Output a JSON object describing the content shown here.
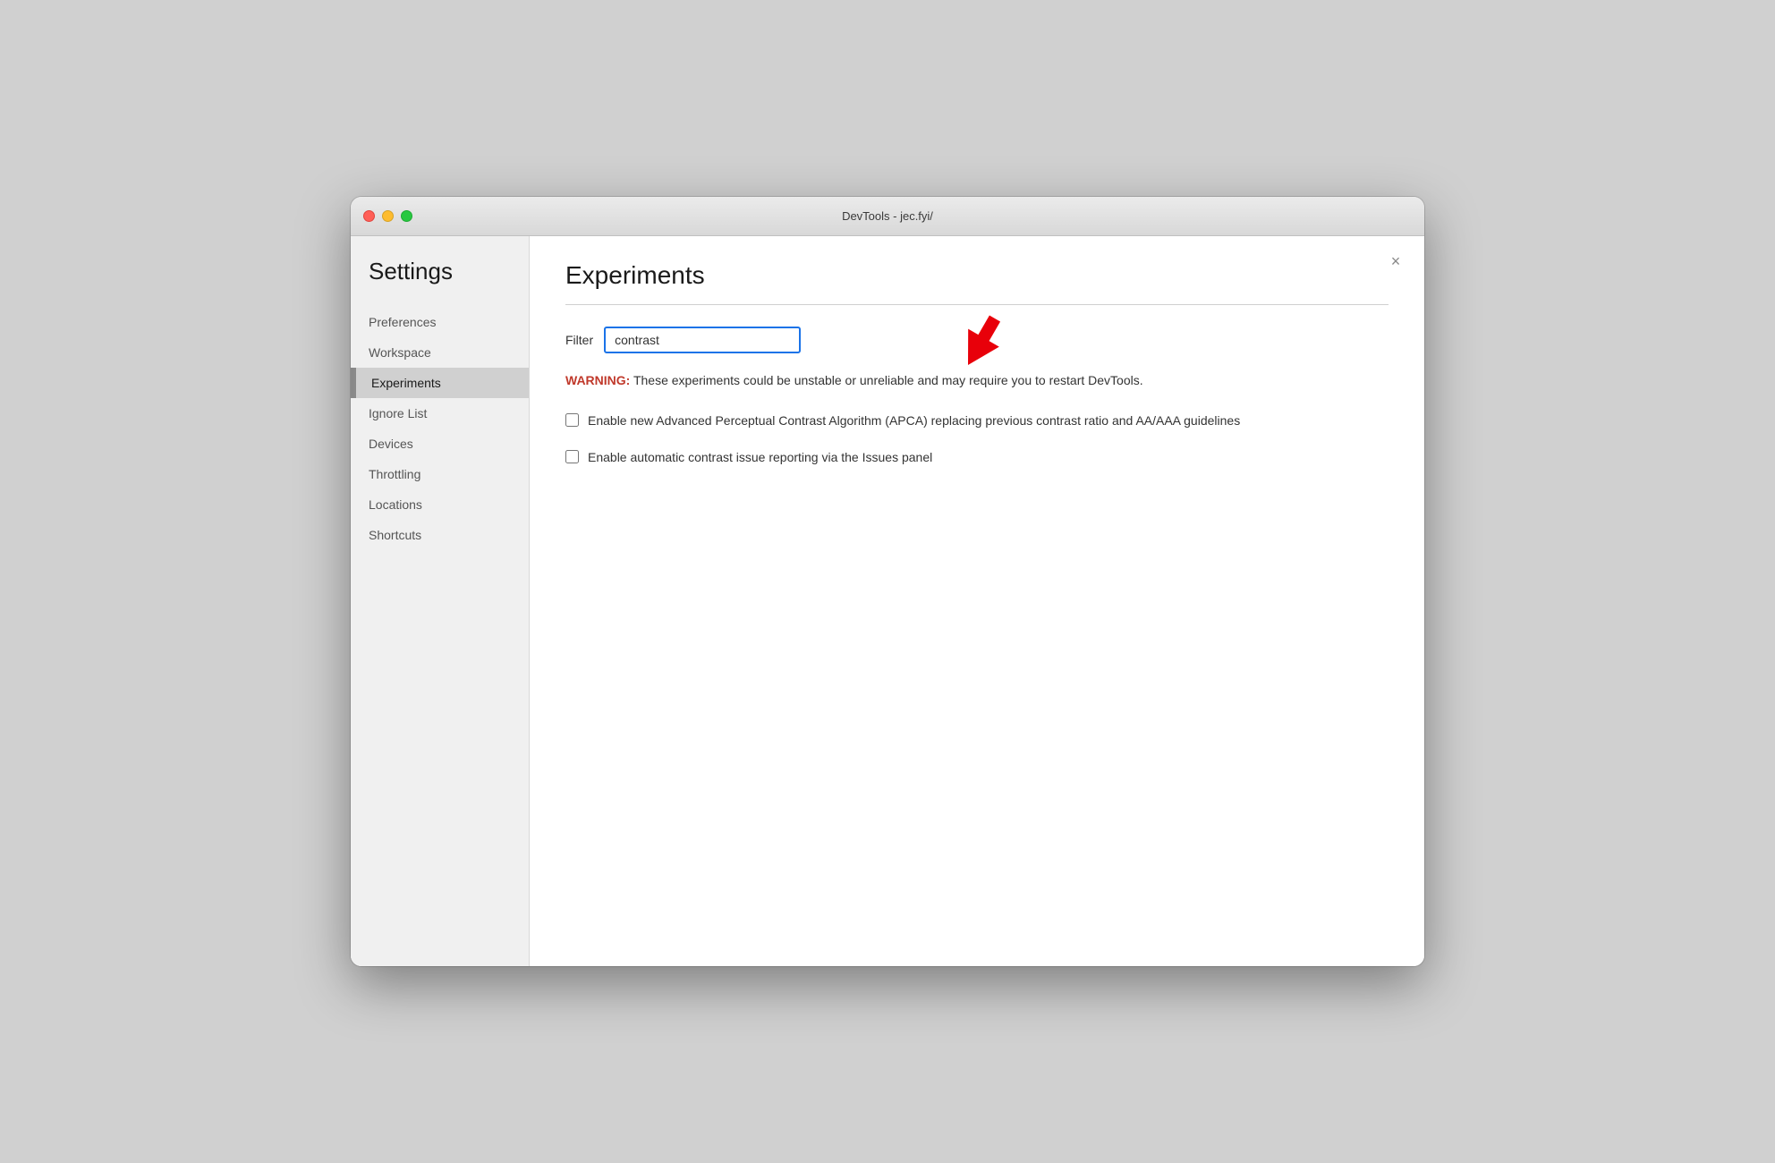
{
  "window": {
    "title": "DevTools - jec.fyi/",
    "close_btn": "×"
  },
  "sidebar": {
    "title": "Settings",
    "items": [
      {
        "id": "preferences",
        "label": "Preferences",
        "active": false
      },
      {
        "id": "workspace",
        "label": "Workspace",
        "active": false
      },
      {
        "id": "experiments",
        "label": "Experiments",
        "active": true
      },
      {
        "id": "ignore-list",
        "label": "Ignore List",
        "active": false
      },
      {
        "id": "devices",
        "label": "Devices",
        "active": false
      },
      {
        "id": "throttling",
        "label": "Throttling",
        "active": false
      },
      {
        "id": "locations",
        "label": "Locations",
        "active": false
      },
      {
        "id": "shortcuts",
        "label": "Shortcuts",
        "active": false
      }
    ]
  },
  "main": {
    "page_title": "Experiments",
    "filter": {
      "label": "Filter",
      "value": "contrast",
      "placeholder": ""
    },
    "warning": {
      "prefix": "WARNING:",
      "text": " These experiments could be unstable or unreliable and may require you to restart DevTools."
    },
    "checkboxes": [
      {
        "id": "apca",
        "label": "Enable new Advanced Perceptual Contrast Algorithm (APCA) replacing previous contrast ratio and AA/AAA guidelines",
        "checked": false
      },
      {
        "id": "auto-contrast",
        "label": "Enable automatic contrast issue reporting via the Issues panel",
        "checked": false
      }
    ]
  },
  "traffic_lights": {
    "close": "close",
    "minimize": "minimize",
    "maximize": "maximize"
  }
}
